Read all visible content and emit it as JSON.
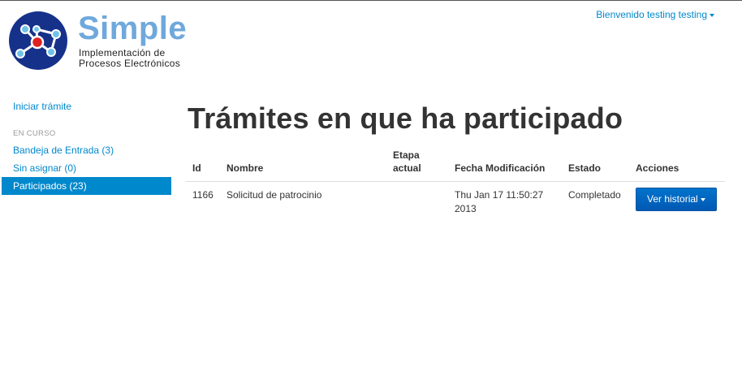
{
  "brand": {
    "name": "Simple",
    "tagline_line1": "Implementación de",
    "tagline_line2": "Procesos Electrónicos"
  },
  "header": {
    "welcome": "Bienvenido testing testing"
  },
  "sidebar": {
    "start": "Iniciar trámite",
    "section": "EN CURSO",
    "items": [
      {
        "label": "Bandeja de Entrada (3)"
      },
      {
        "label": "Sin asignar (0)"
      },
      {
        "label": "Participados (23)",
        "active": true
      }
    ]
  },
  "main": {
    "title": "Trámites en que ha participado",
    "columns": {
      "id": "Id",
      "nombre": "Nombre",
      "etapa_line1": "Etapa",
      "etapa_line2": "actual",
      "fecha": "Fecha Modificación",
      "estado": "Estado",
      "acciones": "Acciones"
    },
    "rows": [
      {
        "id": "1166",
        "nombre": "Solicitud de patrocinio",
        "etapa": "",
        "fecha_line1": "Thu Jan 17 11:50:27",
        "fecha_line2": "2013",
        "estado": "Completado",
        "accion": "Ver historial"
      }
    ]
  },
  "colors": {
    "accent": "#0088cc",
    "button": "#0069c4",
    "logo_circle": "#1a3a8f",
    "logo_red": "#e02020",
    "logo_node": "#6fc3e8"
  }
}
